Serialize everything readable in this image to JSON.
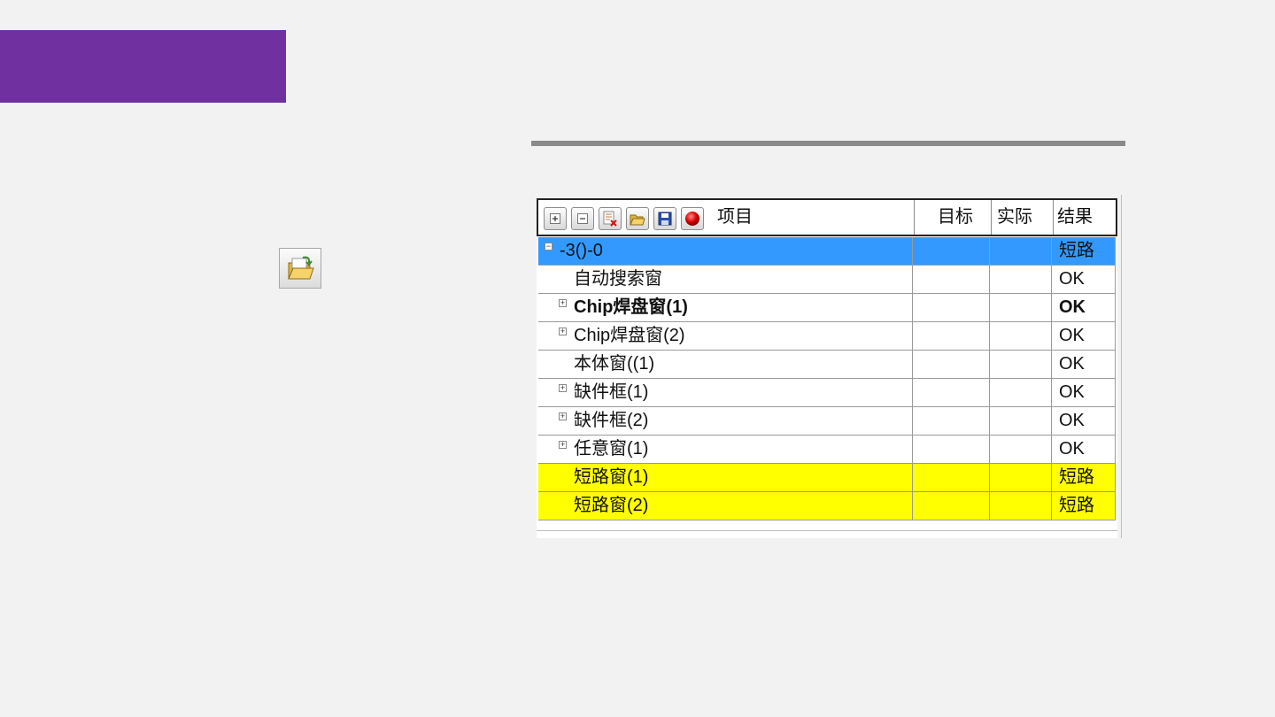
{
  "grid": {
    "columns": {
      "item": "项目",
      "target": "目标",
      "actual": "实际",
      "result": "结果"
    },
    "toolbar": [
      "expand-all-icon",
      "collapse-all-icon",
      "delete-icon",
      "open-folder-icon",
      "save-icon",
      "record-icon"
    ],
    "rows": [
      {
        "expander": "⊟",
        "item": "-3()-0",
        "target": "",
        "actual": "",
        "result": "短路",
        "style": "selected"
      },
      {
        "expander": "",
        "item": "自动搜索窗",
        "target": "",
        "actual": "",
        "result": "OK",
        "style": "normal"
      },
      {
        "expander": "⊞",
        "item": "Chip焊盘窗(1)",
        "target": "",
        "actual": "",
        "result": "OK",
        "style": "bold"
      },
      {
        "expander": "⊞",
        "item": "Chip焊盘窗(2)",
        "target": "",
        "actual": "",
        "result": "OK",
        "style": "normal"
      },
      {
        "expander": "",
        "item": "本体窗((1)",
        "target": "",
        "actual": "",
        "result": "OK",
        "style": "normal"
      },
      {
        "expander": "⊞",
        "item": "缺件框(1)",
        "target": "",
        "actual": "",
        "result": "OK",
        "style": "normal"
      },
      {
        "expander": "⊞",
        "item": "缺件框(2)",
        "target": "",
        "actual": "",
        "result": "OK",
        "style": "normal"
      },
      {
        "expander": "⊞",
        "item": "任意窗(1)",
        "target": "",
        "actual": "",
        "result": "OK",
        "style": "normal"
      },
      {
        "expander": "",
        "item": "短路窗(1)",
        "target": "",
        "actual": "",
        "result": "短路",
        "style": "warning"
      },
      {
        "expander": "",
        "item": "短路窗(2)",
        "target": "",
        "actual": "",
        "result": "短路",
        "style": "warning"
      }
    ]
  },
  "colors": {
    "accent": "#7030a0",
    "selected": "#3399ff",
    "warning": "#ffff00"
  }
}
